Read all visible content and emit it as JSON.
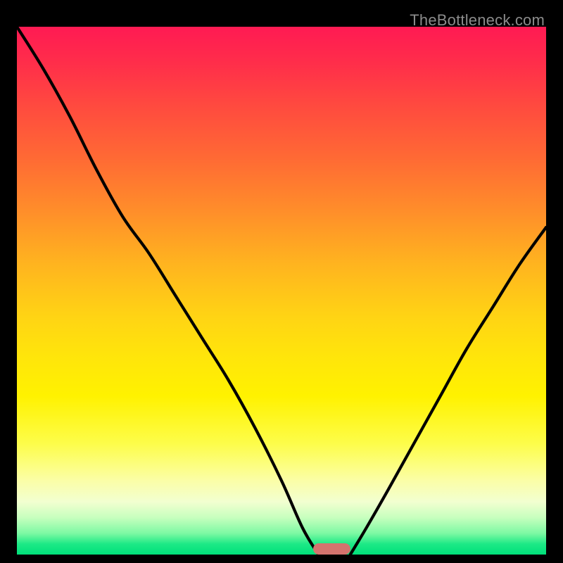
{
  "watermark": "TheBottleneck.com",
  "chart_data": {
    "type": "line",
    "title": "",
    "xlabel": "",
    "ylabel": "",
    "xlim": [
      0,
      100
    ],
    "ylim": [
      0,
      100
    ],
    "grid": false,
    "background_gradient": {
      "direction": "vertical",
      "stops": [
        {
          "pos": 0,
          "color": "#ff1a53"
        },
        {
          "pos": 50,
          "color": "#ffcf12"
        },
        {
          "pos": 80,
          "color": "#fdfd4a"
        },
        {
          "pos": 100,
          "color": "#00e07a"
        }
      ]
    },
    "series": [
      {
        "name": "bottleneck-curve-left",
        "x": [
          0,
          5,
          10,
          15,
          20,
          25,
          30,
          35,
          40,
          45,
          50,
          54,
          57
        ],
        "y": [
          100,
          92,
          83,
          73,
          64,
          57,
          49,
          41,
          33,
          24,
          14,
          5,
          0
        ]
      },
      {
        "name": "bottleneck-curve-right",
        "x": [
          63,
          66,
          70,
          75,
          80,
          85,
          90,
          95,
          100
        ],
        "y": [
          0,
          5,
          12,
          21,
          30,
          39,
          47,
          55,
          62
        ]
      }
    ],
    "optimal_marker": {
      "x_start": 56,
      "x_end": 63,
      "y": 0,
      "color": "#d4736e"
    }
  }
}
